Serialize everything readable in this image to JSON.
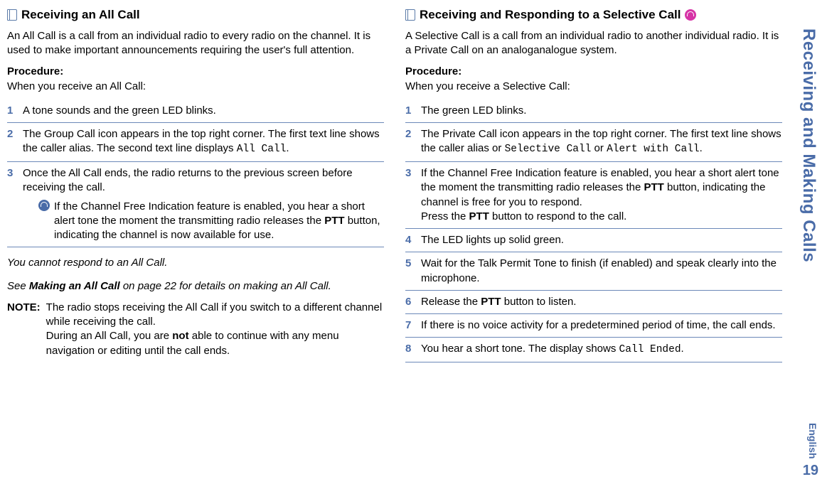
{
  "sidetab": "Receiving and Making Calls",
  "pagenum": "19",
  "english_label": "English",
  "left": {
    "heading": "Receiving an All Call",
    "intro": "An All Call is a call from an individual radio to every radio on the channel. It is used to make important announcements requiring the user's full attention.",
    "proc_label": "Procedure:",
    "proc_when": "When you receive an All Call:",
    "steps": [
      {
        "n": "1",
        "text": "A tone sounds and the green LED blinks."
      },
      {
        "n": "2",
        "prefix": "The Group Call icon appears in the top right corner. The first text line shows the caller alias. The second text line displays ",
        "mono": "All Call",
        "suffix": "."
      },
      {
        "n": "3",
        "text": "Once the All Call ends, the radio returns to the previous screen before receiving the call.",
        "note_prefix": "If the Channel Free Indication feature is enabled, you hear a short alert tone the moment the transmitting radio releases the ",
        "note_bold": "PTT",
        "note_suffix": " button, indicating the channel is now available for use."
      }
    ],
    "italic1": "You cannot respond to an All Call.",
    "see_prefix": "See ",
    "see_bold": "Making an All Call",
    "see_mid": " on page 22 for details on making an All Call.",
    "note_label": "NOTE:",
    "note_body_line1": "The radio stops receiving the All Call if you switch to a different channel while receiving the call.",
    "note_body_prefix": "During an All Call, you are ",
    "note_body_bold": "not",
    "note_body_suffix": " able to continue with any menu navigation or editing until the call ends."
  },
  "right": {
    "heading": "Receiving and Responding to a Selective Call",
    "intro": "A Selective Call is a call from an individual radio to another individual radio. It is a Private Call on an analoganalogue system.",
    "proc_label": "Procedure:",
    "proc_when": "When you receive a Selective Call:",
    "steps": [
      {
        "n": "1",
        "text": "The green LED blinks."
      },
      {
        "n": "2",
        "prefix": "The Private Call icon appears in the top right corner. The first text line shows the caller alias or ",
        "mono1": "Selective Call",
        "mid": " or ",
        "mono2": "Alert with Call",
        "suffix": "."
      },
      {
        "n": "3",
        "prefix": "If the Channel Free Indication feature is enabled, you hear a short alert tone the moment the transmitting radio releases the ",
        "bold1": "PTT",
        "mid1": " button, indicating the channel is free for you to respond.",
        "br": true,
        "prefix2": "Press the ",
        "bold2": "PTT",
        "suffix2": " button to respond to the call."
      },
      {
        "n": "4",
        "text": "The LED lights up solid green."
      },
      {
        "n": "5",
        "text": "Wait for the Talk Permit Tone to finish (if enabled) and speak clearly into the microphone."
      },
      {
        "n": "6",
        "prefix": "Release the ",
        "bold": "PTT",
        "suffix": " button to listen."
      },
      {
        "n": "7",
        "text": "If there is no voice activity for a predetermined period of time, the call ends."
      },
      {
        "n": "8",
        "prefix": "You hear a short tone. The display shows ",
        "mono": "Call Ended",
        "suffix": "."
      }
    ]
  }
}
